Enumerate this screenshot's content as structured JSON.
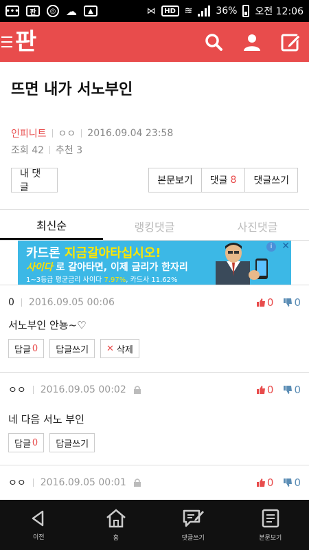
{
  "statusbar": {
    "battery": "36%",
    "time": "오전 12:06"
  },
  "appbar": {
    "logo": "판",
    "icons": [
      "search-icon",
      "user-icon",
      "write-icon"
    ],
    "brand_color": "#e84c4c"
  },
  "post": {
    "title": "뜨면 내가 서노부인",
    "author": "인피니트",
    "nickname": "ㅇㅇ",
    "datetime": "2016.09.04 23:58",
    "views": "조회 42",
    "recommends": "추천 3"
  },
  "buttons": {
    "my_comments": "내 댓글",
    "view_post": "본문보기",
    "comments_label": "댓글",
    "comments_count": "8",
    "write_comment": "댓글쓰기"
  },
  "tabs": [
    {
      "label": "최신순",
      "active": true
    },
    {
      "label": "랭킹댓글",
      "active": false
    },
    {
      "label": "사진댓글",
      "active": false
    }
  ],
  "ad": {
    "line1_a": "카드론 ",
    "line1_b": "지금갈아타십시오!",
    "brand": "사이다",
    "line2": " 로 갈아타면, 이제 금리가 한자리",
    "line3_a": "1~3등급 평균금리 사이다 ",
    "line3_b": "7.97%",
    "line3_c": ", 카드사 11.62%",
    "info": "i",
    "close": "✕"
  },
  "comments": [
    {
      "author": "0",
      "datetime": "2016.09.05 00:06",
      "text": "서노부인 안뇽~♡",
      "up": "0",
      "down": "0",
      "reply_label": "답글",
      "reply_count": "0",
      "write_reply": "답글쓰기",
      "delete": "삭제",
      "locked": false
    },
    {
      "author": "ㅇㅇ",
      "datetime": "2016.09.05 00:02",
      "text": "네 다음 서노 부인",
      "up": "0",
      "down": "0",
      "reply_label": "답글",
      "reply_count": "0",
      "write_reply": "답글쓰기",
      "locked": true
    },
    {
      "author": "ㅇㅇ",
      "datetime": "2016.09.05 00:01",
      "up": "0",
      "down": "0",
      "locked": true
    }
  ],
  "bottomnav": [
    {
      "label": "이전",
      "icon": "back-icon"
    },
    {
      "label": "홈",
      "icon": "home-icon"
    },
    {
      "label": "댓글쓰기",
      "icon": "comment-write-icon"
    },
    {
      "label": "본문보기",
      "icon": "document-icon"
    }
  ]
}
